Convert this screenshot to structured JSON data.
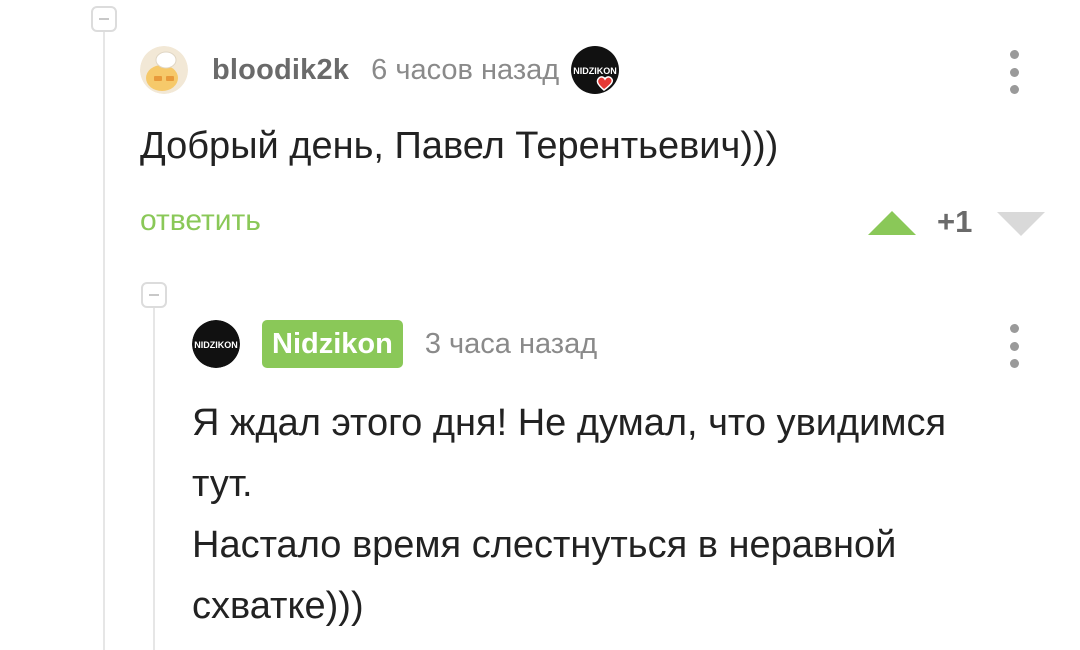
{
  "comment1": {
    "username": "bloodik2k",
    "timestamp": "6 часов назад",
    "avatar_icon": "cartoon-head-avatar-icon",
    "mini_avatar_text": "NIDZIKON",
    "text": "Добрый день, Павел Терентьевич)))",
    "reply_label": "ответить",
    "rating": "+1"
  },
  "comment2": {
    "username": "Nidzikon",
    "timestamp": "3 часа назад",
    "avatar_text": "NIDZIKON",
    "text": "Я ждал этого дня! Не думал, что увидимся\nтут.\nНастало время слестнуться в неравной\nсхватке)))"
  },
  "colors": {
    "accent_green": "#8ac858",
    "muted_text": "#8a8a8a",
    "line": "#e6e6e6"
  }
}
